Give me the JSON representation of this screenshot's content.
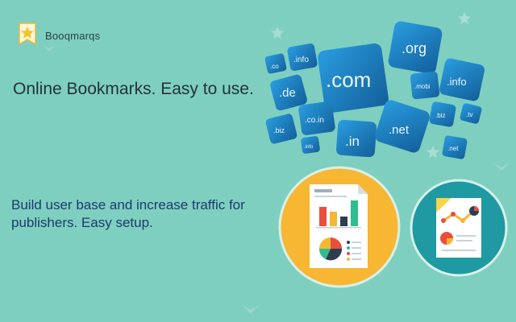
{
  "brand": {
    "name": "Booqmarqs"
  },
  "hero": {
    "headline": "Online Bookmarks. Easy to use.",
    "subline": "Build user base and increase traffic for publishers. Easy setup."
  },
  "domains": {
    "com": ".com",
    "org": ".org",
    "de": ".de",
    "info": ".info",
    "info2": ".info",
    "co": ".co",
    "coin": ".co.in",
    "in": ".in",
    "net": ".net",
    "net2": ".net",
    "biz": ".biz",
    "biz2": ".biz",
    "mobi": ".mobi",
    "tv": ".tv",
    "info3": ".info"
  },
  "colors": {
    "background": "#7ecfbf",
    "cube": "#1a7fc1",
    "orange_circle": "#f7b733",
    "teal_circle": "#1f9aa2"
  }
}
